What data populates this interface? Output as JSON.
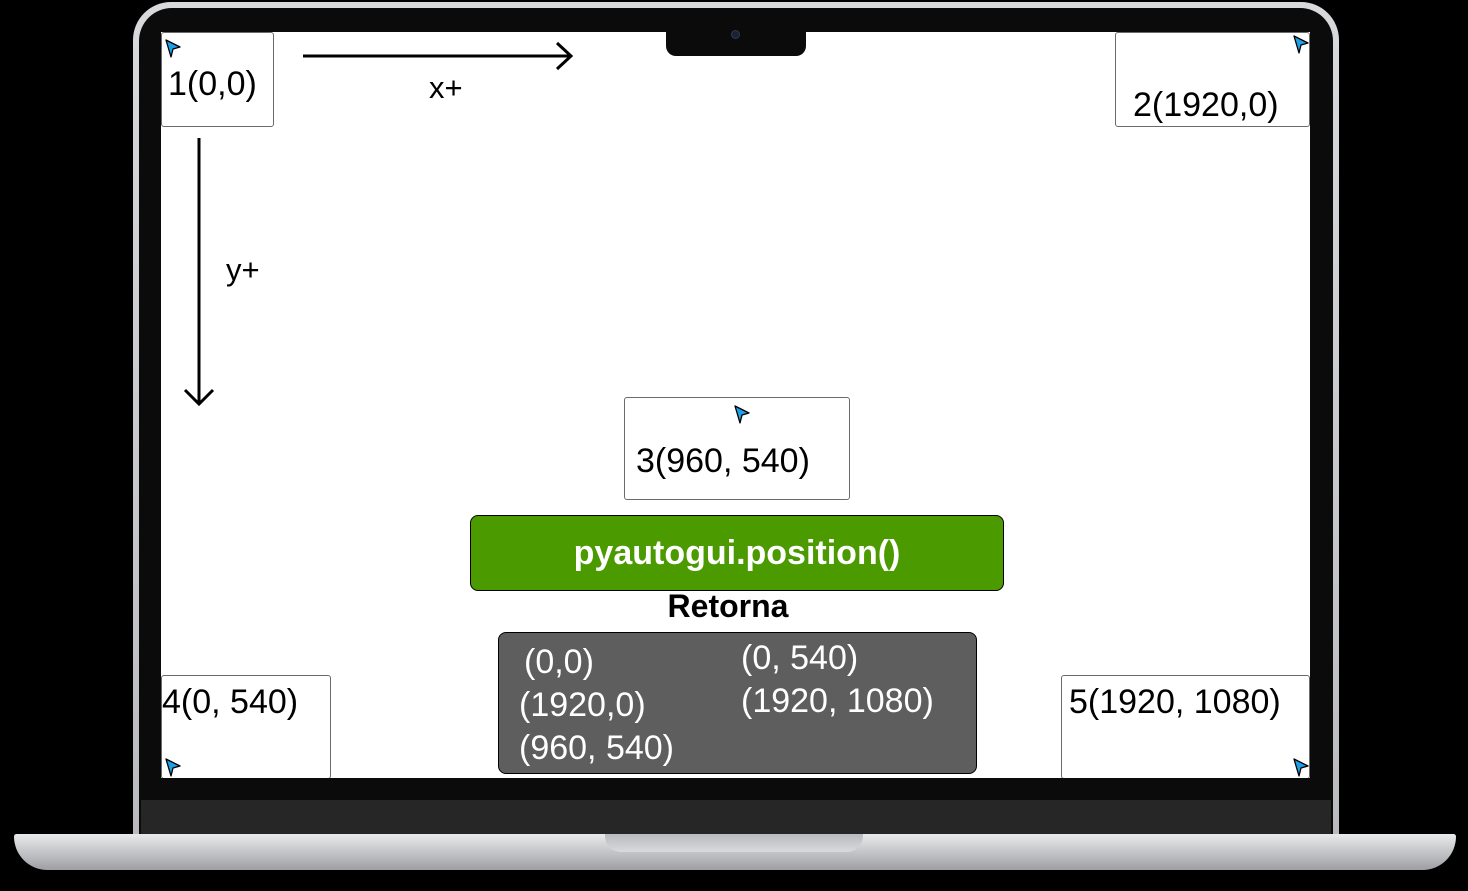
{
  "labels": {
    "p1": "1(0,0)",
    "p2": "2(1920,0)",
    "p3": "3(960, 540)",
    "p4": "4(0, 540)",
    "p5": "5(1920, 1080)",
    "x_axis": "x+",
    "y_axis": "y+"
  },
  "function_call": "pyautogui.position()",
  "returns_title": "Retorna",
  "returns": {
    "left": [
      "(0,0)",
      "(1920,0)",
      "(960, 540)"
    ],
    "right": [
      "(0, 540)",
      "(1920, 1080)"
    ]
  },
  "icons": {
    "cursor": "mouse-pointer-icon",
    "arrow_right": "arrow-right-icon",
    "arrow_down": "arrow-down-icon"
  },
  "colors": {
    "function_box": "#4a9a00",
    "returns_box": "#5e5e5e",
    "cursor_fill": "#1ea0e6"
  }
}
